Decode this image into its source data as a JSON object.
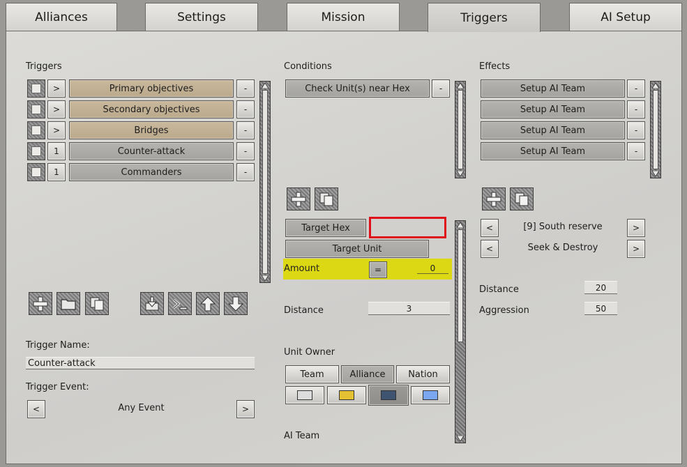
{
  "tabs": [
    {
      "label": "Alliances",
      "active": false
    },
    {
      "label": "Settings",
      "active": false
    },
    {
      "label": "Mission",
      "active": false
    },
    {
      "label": "Triggers",
      "active": true
    },
    {
      "label": "AI Setup",
      "active": false
    }
  ],
  "triggers": {
    "heading": "Triggers",
    "rows": [
      {
        "expand": ">",
        "label": "Primary objectives",
        "remove": "-"
      },
      {
        "expand": ">",
        "label": "Secondary objectives",
        "remove": "-"
      },
      {
        "expand": ">",
        "label": "Bridges",
        "remove": "-"
      },
      {
        "expand": "1",
        "label": "Counter-attack",
        "remove": "-"
      },
      {
        "expand": "1",
        "label": "Commanders",
        "remove": "-"
      }
    ],
    "name_label": "Trigger Name:",
    "name_value": "Counter-attack",
    "event_label": "Trigger Event:",
    "event_prev": "<",
    "event_value": "Any Event",
    "event_next": ">"
  },
  "conditions": {
    "heading": "Conditions",
    "rows": [
      {
        "label": "Check Unit(s) near Hex",
        "remove": "-"
      }
    ],
    "target_hex_label": "Target Hex",
    "target_hex_value": "",
    "target_unit_label": "Target Unit",
    "amount_label": "Amount",
    "amount_op": "=",
    "amount_value": "0",
    "distance_label": "Distance",
    "distance_value": "3",
    "unit_owner_label": "Unit Owner",
    "owner_options": [
      "Team",
      "Alliance",
      "Nation"
    ],
    "owner_selected": "Alliance",
    "swatches": [
      "#dcdcdc",
      "#e3c133",
      "#3e5470",
      "#7aa7ef"
    ],
    "ai_team_label": "AI Team"
  },
  "effects": {
    "heading": "Effects",
    "rows": [
      {
        "label": "Setup AI Team",
        "remove": "-"
      },
      {
        "label": "Setup AI Team",
        "remove": "-"
      },
      {
        "label": "Setup AI Team",
        "remove": "-"
      },
      {
        "label": "Setup AI Team",
        "remove": "-"
      }
    ],
    "selectors": [
      {
        "prev": "<",
        "value": "[9] South reserve",
        "next": ">"
      },
      {
        "prev": "<",
        "value": "Seek & Destroy",
        "next": ">"
      }
    ],
    "distance_label": "Distance",
    "distance_value": "20",
    "aggression_label": "Aggression",
    "aggression_value": "50"
  },
  "colors": {
    "highlight": "#dcd813",
    "marker_red": "#e0101a",
    "tan": "#c3b294"
  }
}
